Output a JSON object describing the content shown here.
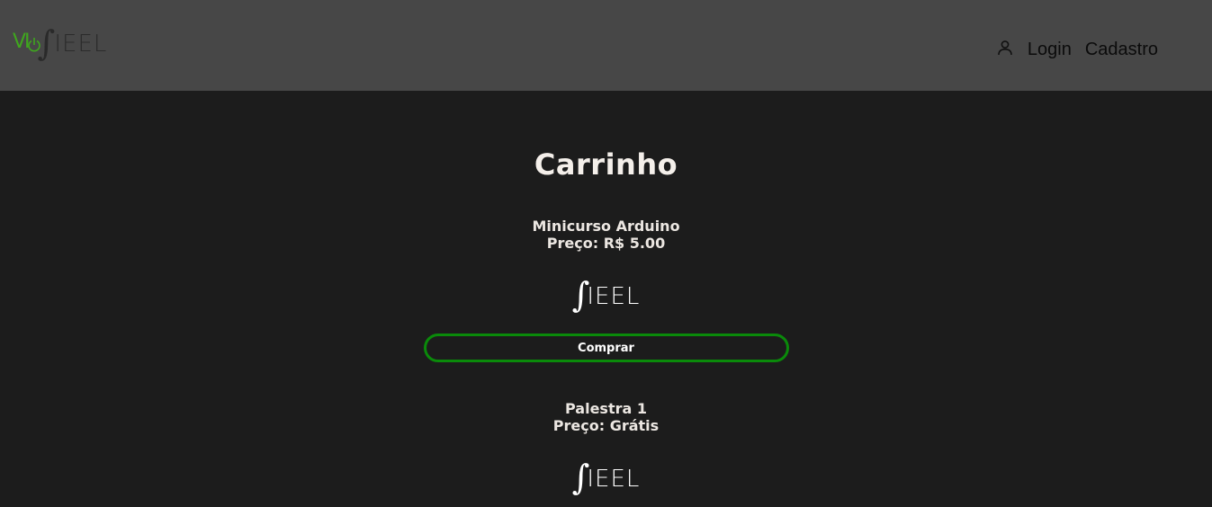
{
  "header": {
    "logo": {
      "prefix": "VI",
      "name": "IEEL",
      "integral": "∫"
    },
    "nav": {
      "login": "Login",
      "signup": "Cadastro",
      "user_icon": "user-icon"
    }
  },
  "cart": {
    "title": "Carrinho",
    "items": [
      {
        "name": "Minicurso Arduino",
        "price": "Preço: R$ 5.00",
        "logo_text": "IEEL",
        "logo_integral": "∫",
        "button": "Comprar"
      },
      {
        "name": "Palestra 1",
        "price": "Preço: Grátis",
        "logo_text": "IEEL",
        "logo_integral": "∫"
      }
    ]
  },
  "colors": {
    "header_bg": "#474747",
    "page_bg": "#1c1c1c",
    "accent_green": "#0a8a0a",
    "logo_green": "#3fa61e"
  }
}
